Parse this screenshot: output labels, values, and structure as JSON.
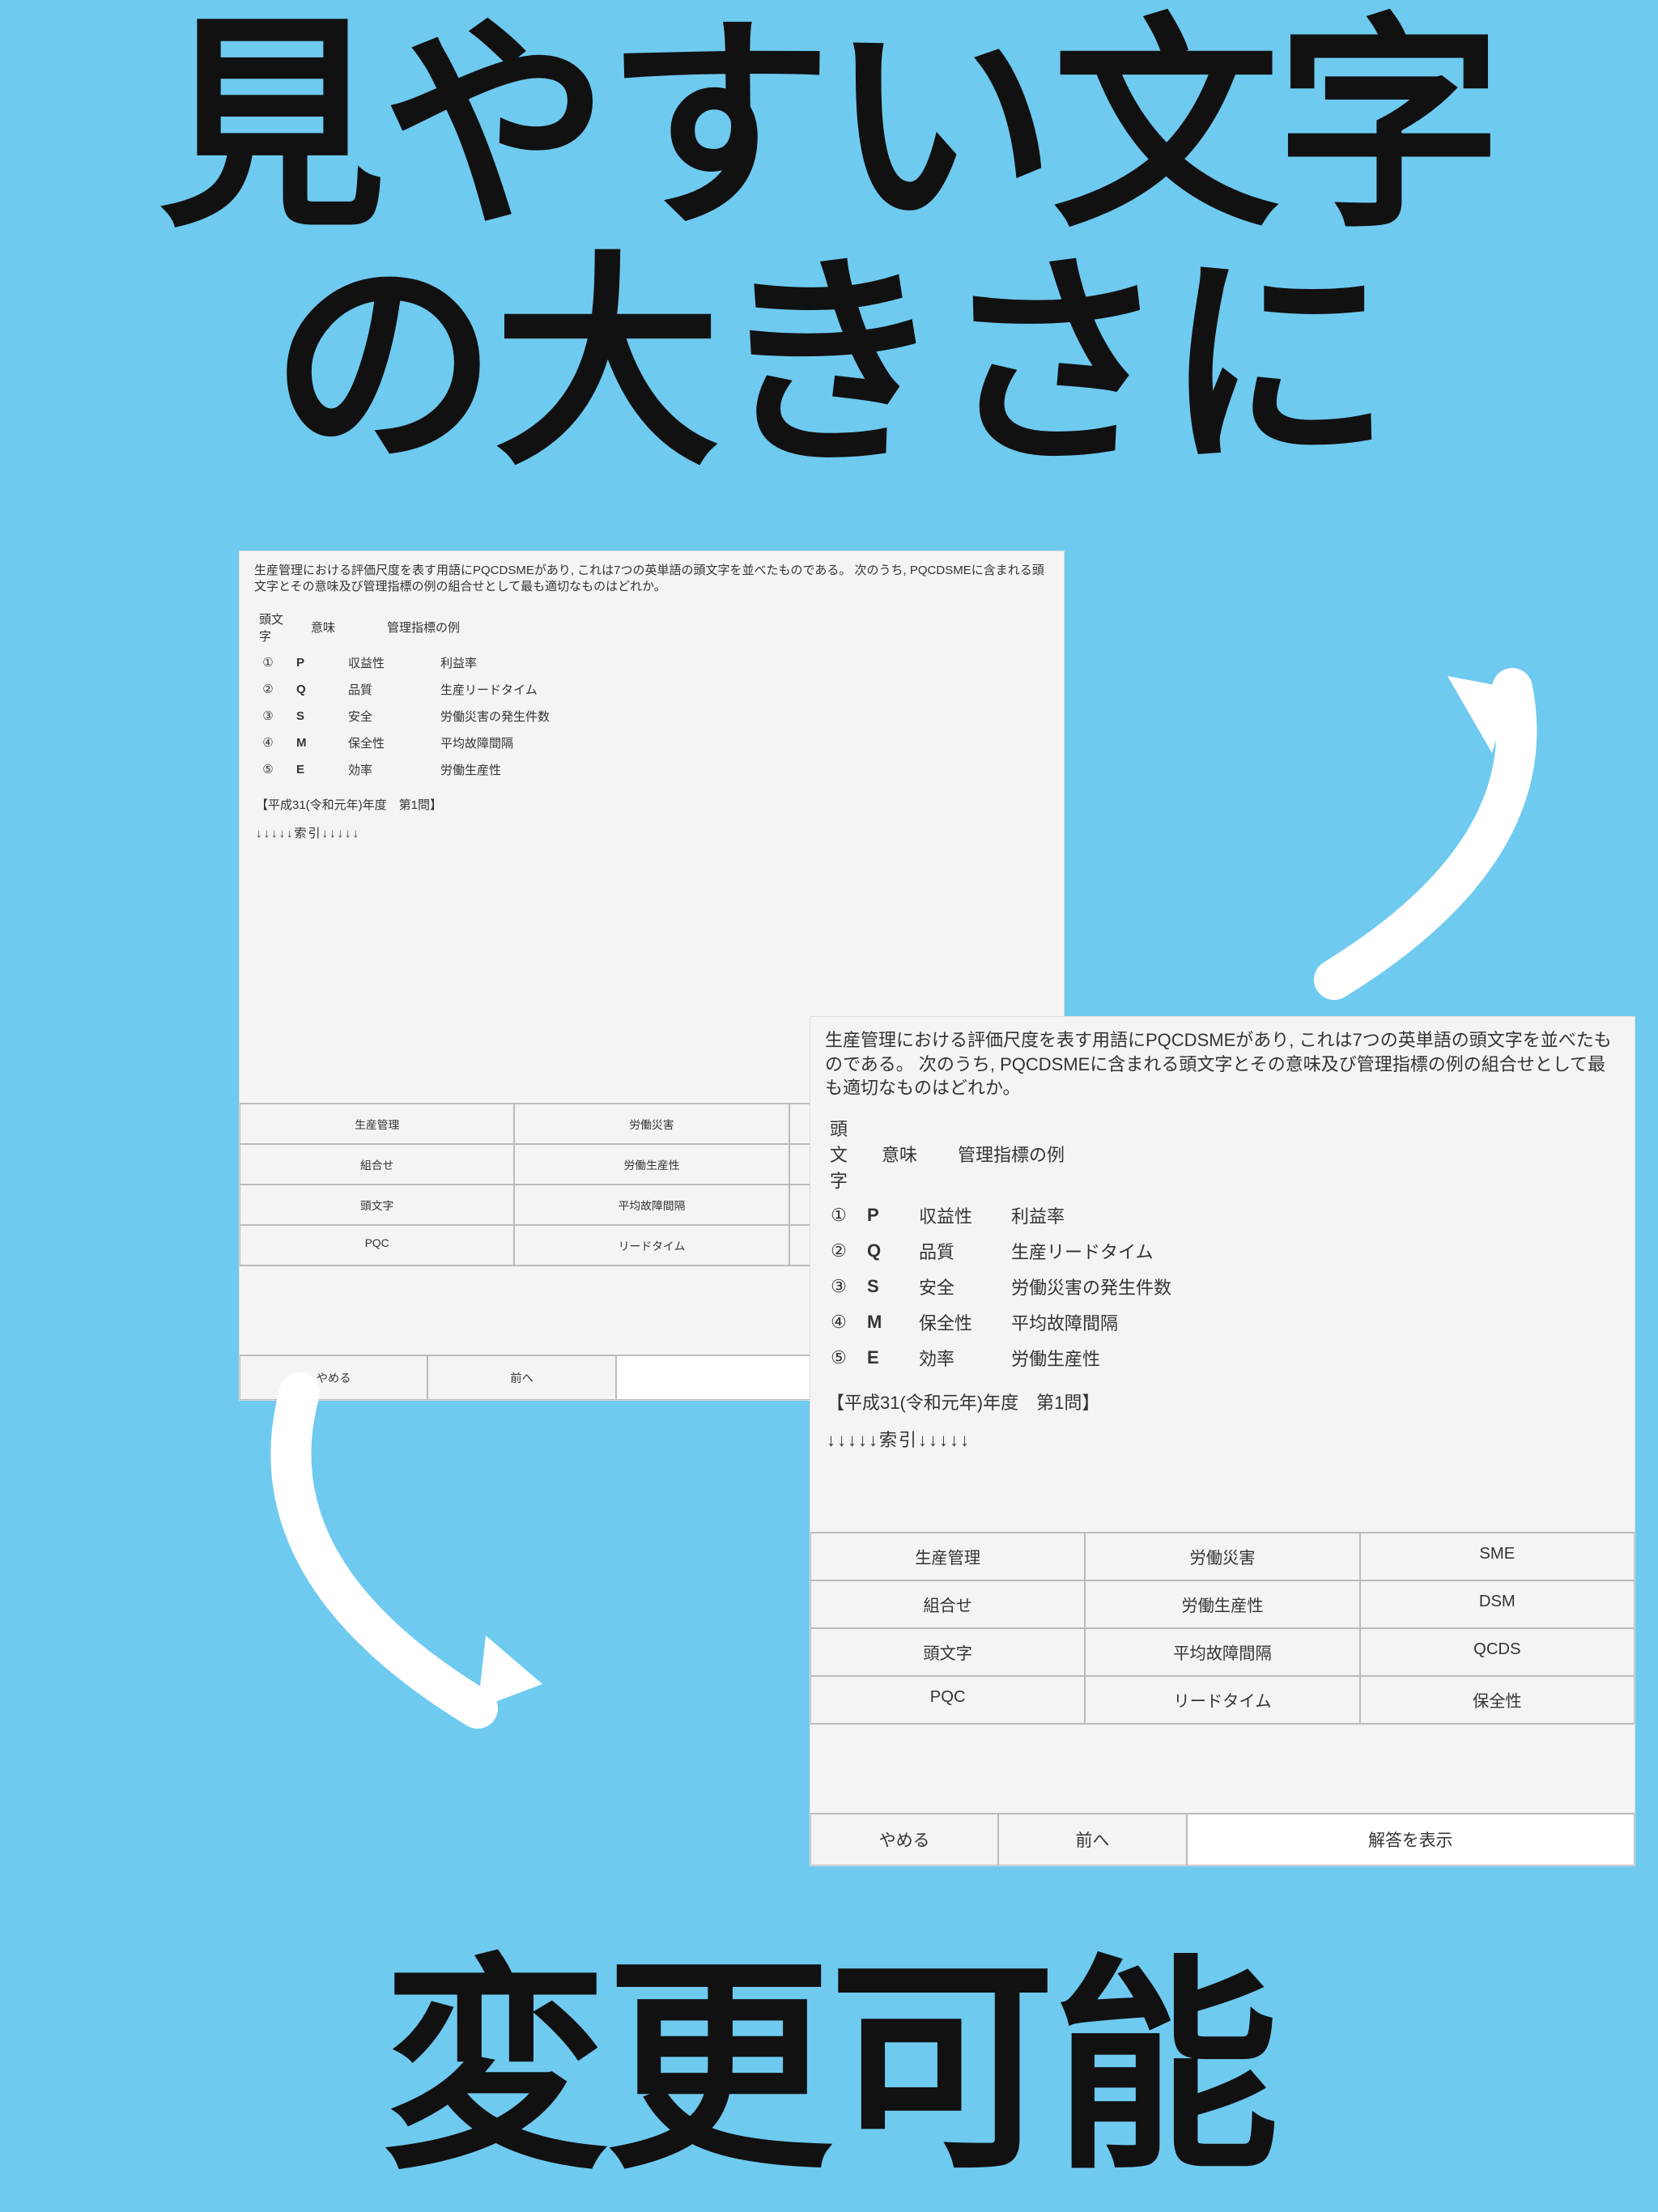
{
  "headline": {
    "top": "見やすい文字\nの大きさに",
    "bottom": "変更可能"
  },
  "question": "生産管理における評価尺度を表す用語にPQCDSMEがあり, これは7つの英単語の頭文字を並べたものである。 次のうち, PQCDSMEに含まれる頭文字とその意味及び管理指標の例の組合せとして最も適切なものはどれか。",
  "opt_header": {
    "c1": "頭文字",
    "c2": "意味",
    "c3": "管理指標の例"
  },
  "options": [
    {
      "num": "①",
      "letter": "P",
      "mean": "収益性",
      "metric": "利益率"
    },
    {
      "num": "②",
      "letter": "Q",
      "mean": "品質",
      "metric": "生産リードタイム"
    },
    {
      "num": "③",
      "letter": "S",
      "mean": "安全",
      "metric": "労働災害の発生件数"
    },
    {
      "num": "④",
      "letter": "M",
      "mean": "保全性",
      "metric": "平均故障間隔"
    },
    {
      "num": "⑤",
      "letter": "E",
      "mean": "効率",
      "metric": "労働生産性"
    }
  ],
  "meta": "【平成31(令和元年)年度　第1問】",
  "index_marker": "↓↓↓↓↓索引↓↓↓↓↓",
  "tags": [
    [
      "生産管理",
      "労働災害",
      "SME"
    ],
    [
      "組合せ",
      "労働生産性",
      "DSM"
    ],
    [
      "頭文字",
      "平均故障間隔",
      "QCDS"
    ],
    [
      "PQC",
      "リードタイム",
      "保全性"
    ]
  ],
  "nav": {
    "quit": "やめる",
    "prev": "前へ",
    "answer": "解答を表示"
  }
}
